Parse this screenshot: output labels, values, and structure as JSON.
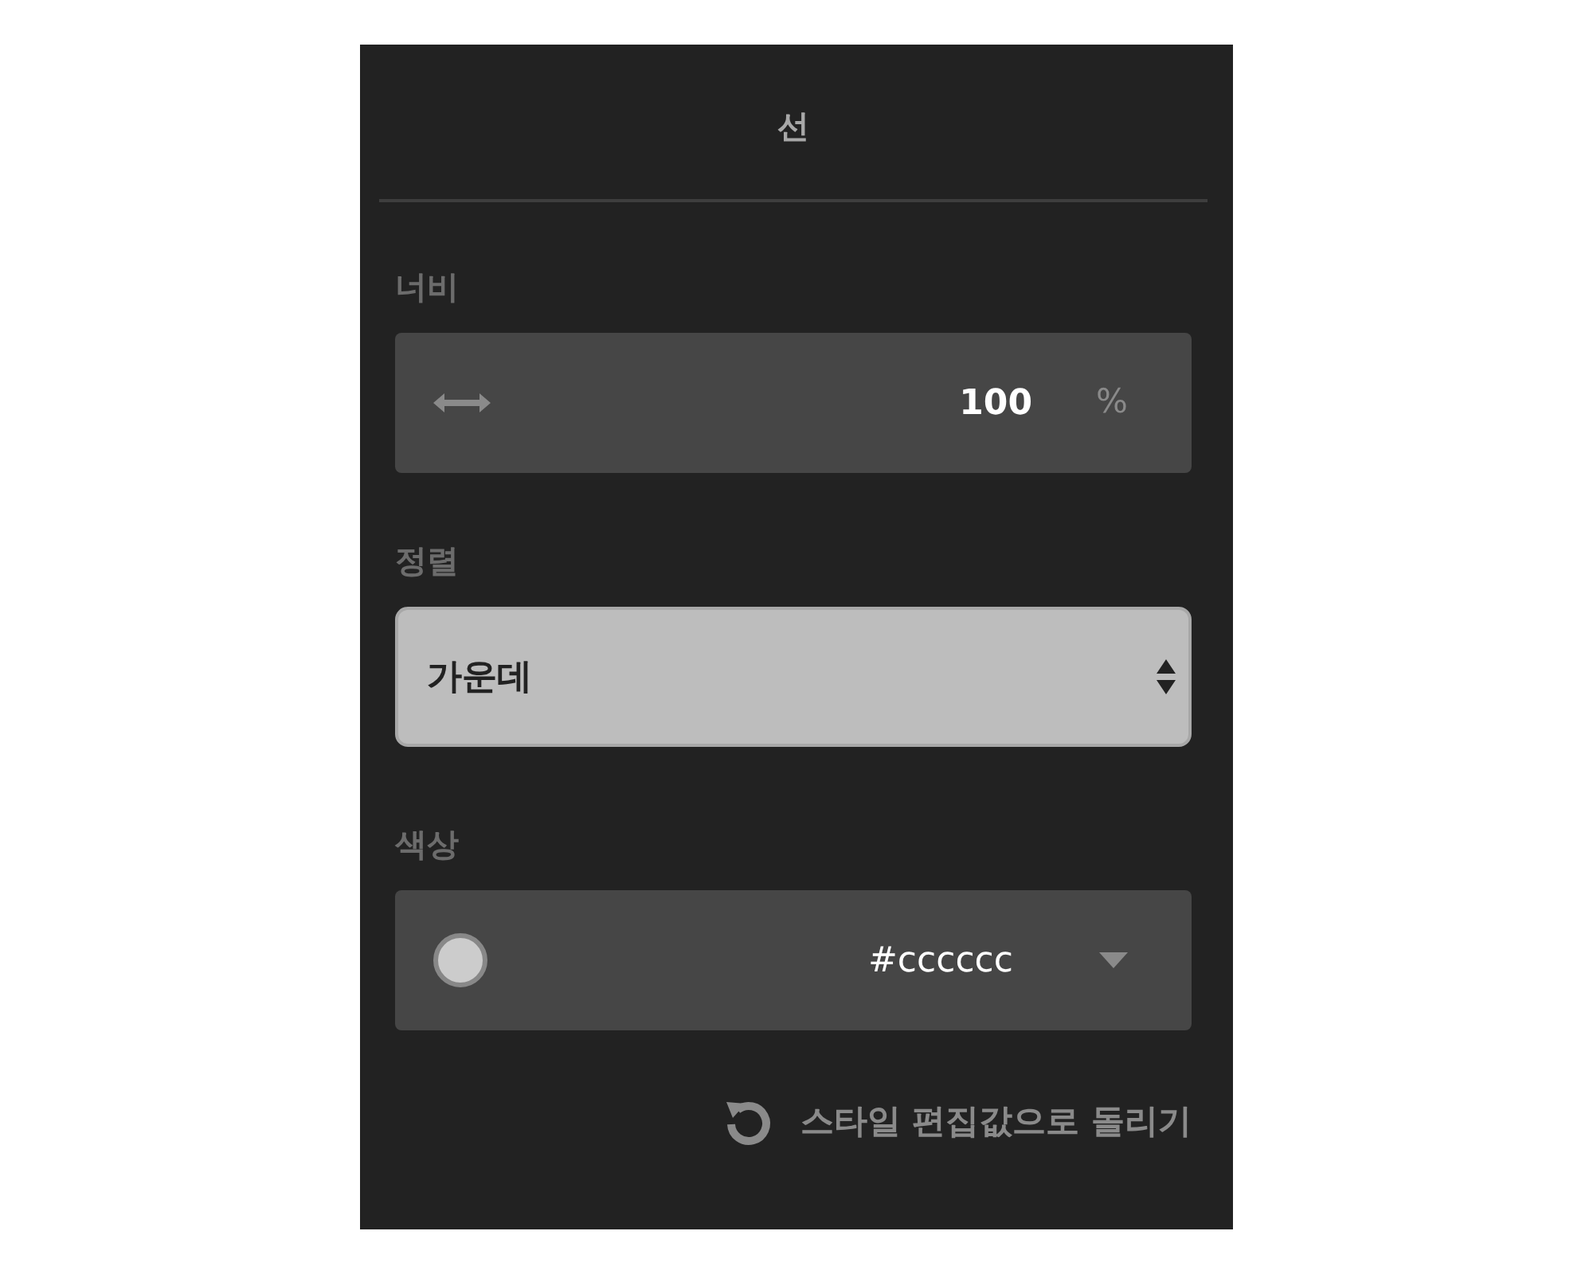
{
  "panel": {
    "title": "선"
  },
  "width": {
    "label": "너비",
    "value": "100",
    "unit": "%"
  },
  "alignment": {
    "label": "정렬",
    "value": "가운데"
  },
  "color": {
    "label": "색상",
    "value": "#cccccc"
  },
  "reset_link": "스타일 편집값으로 돌리기"
}
